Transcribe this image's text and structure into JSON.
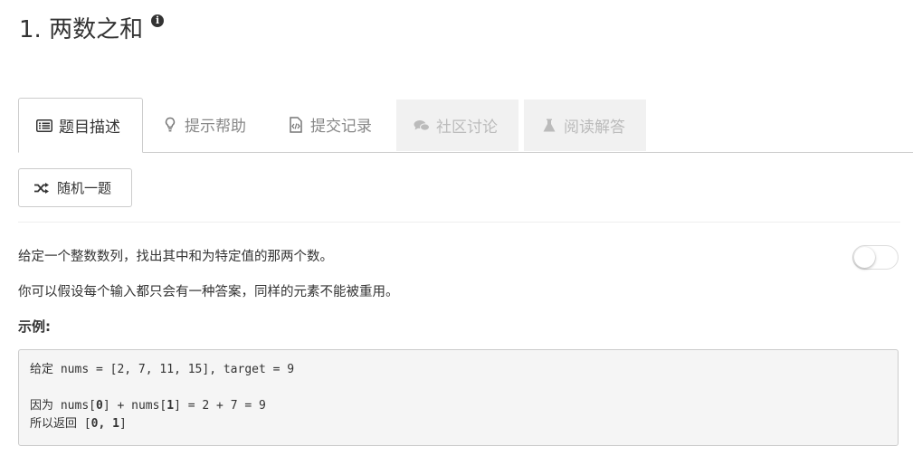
{
  "problem": {
    "title": "1. 两数之和",
    "info_icon": "info-icon"
  },
  "tabs": [
    {
      "label": "题目描述",
      "icon": "list-icon",
      "state": "active"
    },
    {
      "label": "提示帮助",
      "icon": "lightbulb-icon",
      "state": "normal"
    },
    {
      "label": "提交记录",
      "icon": "code-file-icon",
      "state": "normal"
    },
    {
      "label": "社区讨论",
      "icon": "comments-icon",
      "state": "disabled"
    },
    {
      "label": "阅读解答",
      "icon": "flask-icon",
      "state": "disabled"
    }
  ],
  "random_button": {
    "label": "随机一题",
    "icon": "shuffle-icon"
  },
  "description": {
    "line1": "给定一个整数数列，找出其中和为特定值的那两个数。",
    "line2": "你可以假设每个输入都只会有一种答案，同样的元素不能被重用。",
    "example_heading": "示例:"
  },
  "example_code": {
    "given_word": "给定",
    "given_rest": " nums = [2, 7, 11, 15], target = 9",
    "because_word": "因为",
    "because_a": " nums[",
    "because_b": "0",
    "because_c": "] + nums[",
    "because_d": "1",
    "because_e": "] = 2 + 7 = 9",
    "return_word": "所以返回",
    "return_a": " [",
    "return_b": "0, 1",
    "return_c": "]"
  },
  "toggle": {
    "state": "off"
  },
  "colors": {
    "active_text": "#333333",
    "muted_text": "#888888",
    "disabled_bg": "#f1f1f1",
    "code_bg": "#f5f5f5"
  }
}
